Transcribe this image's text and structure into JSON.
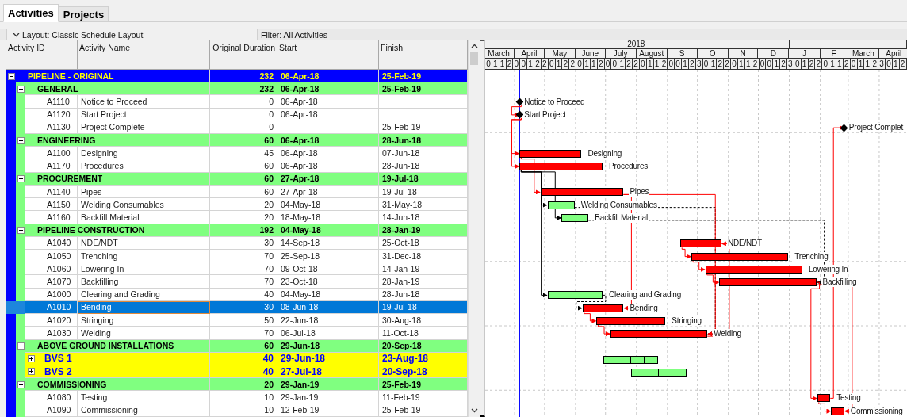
{
  "tabs": [
    {
      "label": "Activities",
      "selected": true
    },
    {
      "label": "Projects",
      "selected": false
    }
  ],
  "toolbar": {
    "layout": "Layout: Classic Schedule Layout",
    "filter": "Filter: All Activities"
  },
  "table": {
    "columns": [
      "Activity ID",
      "Activity Name",
      "Original Duration",
      "Start",
      "Finish"
    ],
    "rows": [
      {
        "kind": "project",
        "name": "PIPELINE - ORIGINAL",
        "duration": "232",
        "start": "06-Apr-18",
        "finish": "25-Feb-19",
        "expanded": true,
        "children": [
          {
            "kind": "wbs",
            "name": "GENERAL",
            "duration": "232",
            "start": "06-Apr-18",
            "finish": "25-Feb-19",
            "expanded": true,
            "children": [
              {
                "kind": "activity",
                "id": "A1110",
                "name": "Notice to Proceed",
                "duration": "0",
                "start": "06-Apr-18",
                "selected": false,
                "bar": {
                  "kind": "milestone",
                  "label": "Notice to Proceed"
                }
              },
              {
                "kind": "activity",
                "id": "A1120",
                "name": "Start Project",
                "duration": "0",
                "start": "06-Apr-18",
                "selected": false,
                "bar": {
                  "kind": "milestone",
                  "label": "Start Project"
                }
              },
              {
                "kind": "activity",
                "id": "A1130",
                "name": "Project Complete",
                "duration": "0",
                "finish": "25-Feb-19",
                "selected": false,
                "bar": {
                  "kind": "milestone",
                  "label": "Project Complet"
                }
              }
            ]
          },
          {
            "kind": "wbs",
            "name": "ENGINEERING",
            "duration": "60",
            "start": "06-Apr-18",
            "finish": "28-Jun-18",
            "expanded": true,
            "children": [
              {
                "kind": "activity",
                "id": "A1100",
                "name": "Designing",
                "duration": "45",
                "start": "06-Apr-18",
                "finish": "07-Jun-18",
                "selected": false,
                "bar": {
                  "kind": "critical",
                  "label": "Designing"
                }
              },
              {
                "kind": "activity",
                "id": "A1170",
                "name": "Procedures",
                "duration": "60",
                "start": "06-Apr-18",
                "finish": "28-Jun-18",
                "selected": false,
                "bar": {
                  "kind": "critical",
                  "label": "Procedures"
                }
              }
            ]
          },
          {
            "kind": "wbs",
            "name": "PROCUREMENT",
            "duration": "60",
            "start": "27-Apr-18",
            "finish": "19-Jul-18",
            "expanded": true,
            "children": [
              {
                "kind": "activity",
                "id": "A1140",
                "name": "Pipes",
                "duration": "60",
                "start": "27-Apr-18",
                "finish": "19-Jul-18",
                "selected": false,
                "bar": {
                  "kind": "critical",
                  "label": "Pipes"
                }
              },
              {
                "kind": "activity",
                "id": "A1150",
                "name": "Welding Consumables",
                "duration": "20",
                "start": "04-May-18",
                "finish": "31-May-18",
                "selected": false,
                "bar": {
                  "kind": "normal",
                  "label": "Welding Consumables"
                }
              },
              {
                "kind": "activity",
                "id": "A1160",
                "name": "Backfill Material",
                "duration": "20",
                "start": "18-May-18",
                "finish": "14-Jun-18",
                "selected": false,
                "bar": {
                  "kind": "normal",
                  "label": "Backfill Material"
                }
              }
            ]
          },
          {
            "kind": "wbs",
            "name": "PIPELINE CONSTRUCTION",
            "duration": "192",
            "start": "04-May-18",
            "finish": "28-Jan-19",
            "expanded": true,
            "children": [
              {
                "kind": "activity",
                "id": "A1040",
                "name": "NDE/NDT",
                "duration": "30",
                "start": "14-Sep-18",
                "finish": "25-Oct-18",
                "selected": false,
                "bar": {
                  "kind": "critical",
                  "label": "NDE/NDT"
                }
              },
              {
                "kind": "activity",
                "id": "A1050",
                "name": "Trenching",
                "duration": "70",
                "start": "25-Sep-18",
                "finish": "31-Dec-18",
                "selected": false,
                "bar": {
                  "kind": "critical",
                  "label": "Trenching"
                }
              },
              {
                "kind": "activity",
                "id": "A1060",
                "name": "Lowering In",
                "duration": "70",
                "start": "09-Oct-18",
                "finish": "14-Jan-19",
                "selected": false,
                "bar": {
                  "kind": "critical",
                  "label": "Lowering In"
                }
              },
              {
                "kind": "activity",
                "id": "A1070",
                "name": "Backfilling",
                "duration": "70",
                "start": "23-Oct-18",
                "finish": "28-Jan-19",
                "selected": false,
                "bar": {
                  "kind": "critical",
                  "label": "Backfilling"
                }
              },
              {
                "kind": "activity",
                "id": "A1000",
                "name": "Clearing and Grading",
                "duration": "40",
                "start": "04-May-18",
                "finish": "28-Jun-18",
                "selected": false,
                "bar": {
                  "kind": "normal",
                  "label": "Clearing and Grading"
                }
              },
              {
                "kind": "activity",
                "id": "A1010",
                "name": "Bending",
                "duration": "30",
                "start": "08-Jun-18",
                "finish": "19-Jul-18",
                "selected": true,
                "bar": {
                  "kind": "critical",
                  "label": "Bending"
                }
              },
              {
                "kind": "activity",
                "id": "A1020",
                "name": "Stringing",
                "duration": "50",
                "start": "22-Jun-18",
                "finish": "30-Aug-18",
                "selected": false,
                "bar": {
                  "kind": "critical",
                  "label": "Stringing"
                }
              },
              {
                "kind": "activity",
                "id": "A1030",
                "name": "Welding",
                "duration": "70",
                "start": "06-Jul-18",
                "finish": "11-Oct-18",
                "selected": false,
                "bar": {
                  "kind": "critical",
                  "label": "Welding"
                }
              }
            ]
          },
          {
            "kind": "wbs",
            "name": "ABOVE GROUND INSTALLATIONS",
            "duration": "60",
            "start": "29-Jun-18",
            "finish": "20-Sep-18",
            "expanded": true,
            "children": [
              {
                "kind": "summary",
                "name": "BVS 1",
                "duration": "40",
                "start": "29-Jun-18",
                "finish": "23-Aug-18",
                "expanded": false,
                "bar": {
                  "kind": "summary"
                }
              },
              {
                "kind": "summary",
                "name": "BVS 2",
                "duration": "40",
                "start": "27-Jul-18",
                "finish": "20-Sep-18",
                "expanded": false,
                "bar": {
                  "kind": "summary"
                }
              }
            ]
          },
          {
            "kind": "wbs",
            "name": "COMMISSIONING",
            "duration": "20",
            "start": "29-Jan-19",
            "finish": "25-Feb-19",
            "expanded": true,
            "children": [
              {
                "kind": "activity",
                "id": "A1080",
                "name": "Testing",
                "duration": "10",
                "start": "29-Jan-19",
                "finish": "11-Feb-19",
                "selected": false,
                "bar": {
                  "kind": "critical",
                  "label": "Testing"
                }
              },
              {
                "kind": "activity",
                "id": "A1090",
                "name": "Commissioning",
                "duration": "10",
                "start": "12-Feb-19",
                "finish": "25-Feb-19",
                "selected": false,
                "bar": {
                  "kind": "critical",
                  "label": "Commissioning"
                }
              }
            ]
          }
        ]
      }
    ]
  },
  "gantt": {
    "timescale": {
      "year": "2018",
      "months": [
        "March",
        "April",
        "May",
        "June",
        "July",
        "August",
        "S",
        "O",
        "N",
        "D",
        "J",
        "F",
        "March",
        "April"
      ],
      "weeks": [
        "0",
        "1",
        "1",
        "2",
        "0",
        "0",
        "1",
        "2",
        "2",
        "0",
        "1",
        "2",
        "2",
        "0",
        "1",
        "1",
        "2",
        "0",
        "0",
        "1",
        "2",
        "2",
        "0",
        "1",
        "1",
        "2",
        "0",
        "0",
        "1",
        "2",
        "3",
        "0",
        "1",
        "2",
        "2",
        "0",
        "1",
        "1",
        "2",
        "0",
        "0",
        "1",
        "2",
        "3",
        "0",
        "1",
        "2",
        "2",
        "0",
        "1",
        "1",
        "2",
        "0",
        "1",
        "1",
        "2",
        "3",
        "0",
        "1",
        "2"
      ]
    }
  }
}
